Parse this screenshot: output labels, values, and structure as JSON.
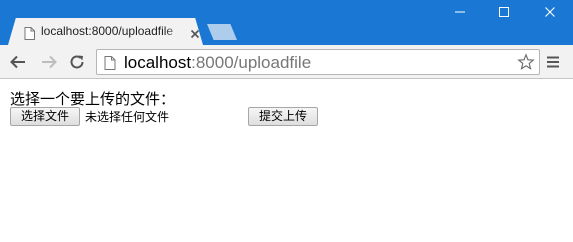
{
  "browser": {
    "tab": {
      "title": "localhost:8000/uploadfile"
    },
    "address_bar": {
      "host": "localhost",
      "path": ":8000/uploadfile"
    },
    "window_controls": [
      "minimize",
      "maximize",
      "close"
    ],
    "colors": {
      "titlebar": "#1a78d4",
      "toolbar": "#f2f2f2"
    }
  },
  "page": {
    "prompt": "选择一个要上传的文件：",
    "file_input": {
      "button_label": "选择文件",
      "status": "未选择任何文件"
    },
    "submit_label": "提交上传"
  },
  "icons": [
    "page-favicon-icon",
    "close-icon",
    "minimize-icon",
    "maximize-icon",
    "back-arrow-icon",
    "forward-arrow-icon",
    "reload-icon",
    "page-icon",
    "star-icon",
    "menu-icon"
  ]
}
